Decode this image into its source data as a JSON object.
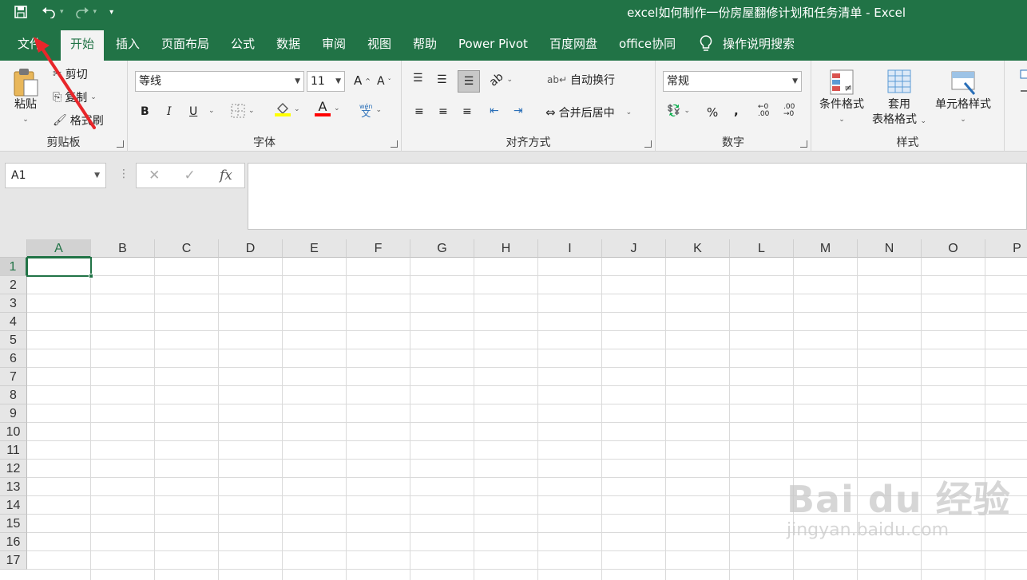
{
  "window": {
    "title": "excel如何制作一份房屋翻修计划和任务清单  -  Excel"
  },
  "tabs": [
    {
      "label": "文件"
    },
    {
      "label": "开始"
    },
    {
      "label": "插入"
    },
    {
      "label": "页面布局"
    },
    {
      "label": "公式"
    },
    {
      "label": "数据"
    },
    {
      "label": "审阅"
    },
    {
      "label": "视图"
    },
    {
      "label": "帮助"
    },
    {
      "label": "Power Pivot"
    },
    {
      "label": "百度网盘"
    },
    {
      "label": "office协同"
    }
  ],
  "active_tab": "开始",
  "tell_me": "操作说明搜索",
  "clipboard": {
    "paste": "粘贴",
    "cut": "剪切",
    "copy": "复制",
    "format_painter": "格式刷",
    "label": "剪贴板"
  },
  "font": {
    "name": "等线",
    "size": "11",
    "bold": "B",
    "italic": "I",
    "underline": "U",
    "label": "字体",
    "fill_color": "#ffff00",
    "font_color": "#ff0000"
  },
  "alignment": {
    "wrap": "自动换行",
    "merge": "合并后居中",
    "label": "对齐方式"
  },
  "number": {
    "format": "常规",
    "percent": "%",
    "comma": ",",
    "label": "数字"
  },
  "styles": {
    "conditional": "条件格式",
    "table_line1": "套用",
    "table_line2": "表格格式",
    "cell_styles": "单元格样式",
    "label": "样式"
  },
  "formula_bar": {
    "name_box": "A1",
    "fx": "fx",
    "content": ""
  },
  "columns": [
    "A",
    "B",
    "C",
    "D",
    "E",
    "F",
    "G",
    "H",
    "I",
    "J",
    "K",
    "L",
    "M",
    "N",
    "O",
    "P"
  ],
  "rows": [
    "1",
    "2",
    "3",
    "4",
    "5",
    "6",
    "7",
    "8",
    "9",
    "10",
    "11",
    "12",
    "13",
    "14",
    "15",
    "16",
    "17"
  ],
  "selected_cell": "A1",
  "watermark": {
    "main": "Bai du 经验",
    "url": "jingyan.baidu.com"
  },
  "colors": {
    "accent": "#217346",
    "annotation_arrow": "#e8262a"
  }
}
